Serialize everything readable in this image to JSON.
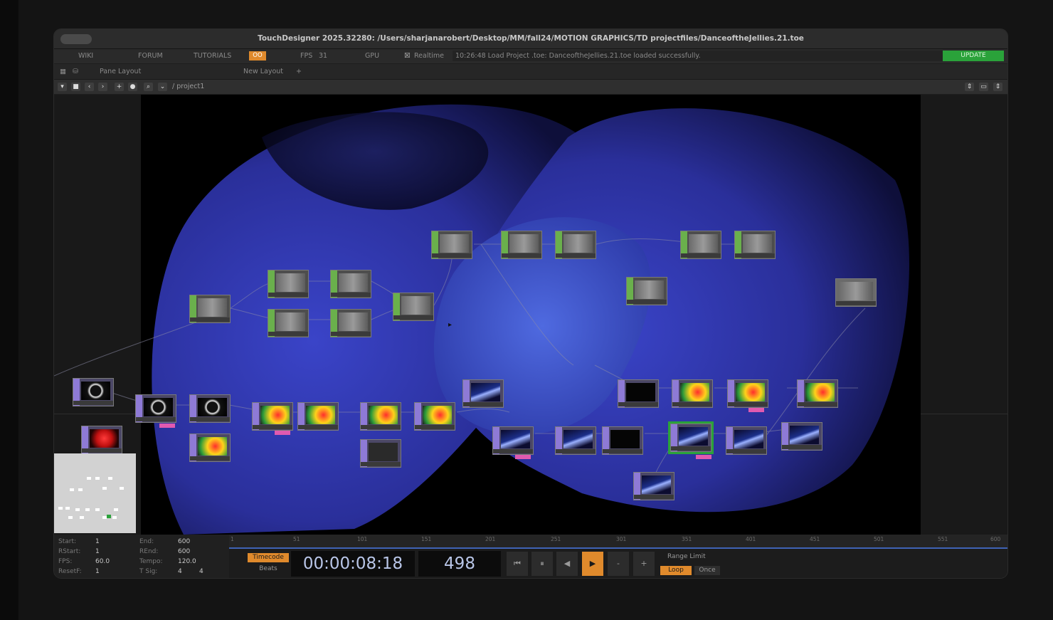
{
  "window": {
    "title": "TouchDesigner 2025.32280: /Users/sharjanarobert/Desktop/MM/fall24/MOTION GRAPHICS/TD projectfiles/DanceoftheJellies.21.toe"
  },
  "menubar": {
    "wiki": "WIKI",
    "forum": "FORUM",
    "tutorials": "TUTORIALS",
    "perf": "OO",
    "fps_label": "FPS",
    "fps_value": "31",
    "gpu": "GPU",
    "realtime": "Realtime",
    "message": "10:26:48 Load Project .toe: DanceoftheJellies.21.toe loaded successfully.",
    "update": "UPDATE"
  },
  "layoutbar": {
    "pane_layout": "Pane Layout",
    "new_layout": "New Layout",
    "add": "+"
  },
  "pathbar": {
    "path": "/ project1"
  },
  "info": {
    "start_label": "Start:",
    "start": "1",
    "rstart_label": "RStart:",
    "rstart": "1",
    "fps_label": "FPS:",
    "fps": "60.0",
    "resetf_label": "ResetF:",
    "resetf": "1",
    "end_label": "End:",
    "end": "600",
    "rend_label": "REnd:",
    "rend": "600",
    "tempo_label": "Tempo:",
    "tempo": "120.0",
    "tsig_label": "T Sig:",
    "tsig_a": "4",
    "tsig_b": "4"
  },
  "timeline": {
    "ticks": [
      "1",
      "51",
      "101",
      "151",
      "201",
      "251",
      "301",
      "351",
      "401",
      "451",
      "501",
      "551",
      "600"
    ],
    "timecode_btn": "Timecode",
    "beats_btn": "Beats",
    "timecode": "00:00:08:18",
    "frame": "498",
    "range_limit": "Range Limit",
    "loop": "Loop",
    "once": "Once"
  },
  "colors": {
    "accent_orange": "#e08a2c",
    "update_green": "#2aa23a",
    "top_tag_green": "#6ab04c",
    "chop_tag_purple": "#8e7ad6",
    "timeline_blue": "#3f63b5"
  }
}
